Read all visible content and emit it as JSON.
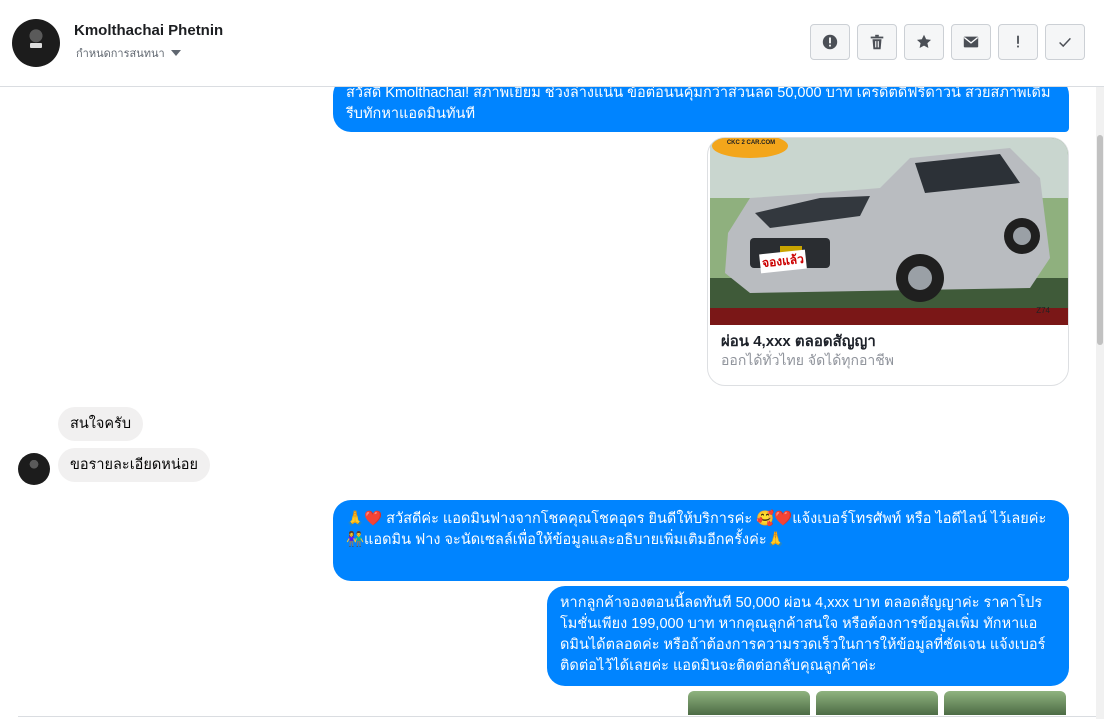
{
  "header": {
    "contact_name": "Kmolthachai Phetnin",
    "conversation_settings_label": "กำหนดการสนทนา",
    "toolbar": [
      {
        "name": "report-spam-button",
        "icon": "alert-circle-icon"
      },
      {
        "name": "delete-button",
        "icon": "trash-icon"
      },
      {
        "name": "star-button",
        "icon": "star-icon"
      },
      {
        "name": "mark-unread-button",
        "icon": "envelope-icon"
      },
      {
        "name": "follow-up-button",
        "icon": "exclamation-icon"
      },
      {
        "name": "mark-done-button",
        "icon": "check-icon"
      }
    ]
  },
  "messages": {
    "outgoing_1": "สวัสดี Kmolthachai! สภาพเยี่ยม ช่วงล่างแน่น ข้อต่อนนคุ้มกว่าส่วนลด 50,000 บาท เครดิตดีฟรีดาวน์ สวยสภาพเดิม รีบทักหาแอดมินทันที",
    "card": {
      "title": "ผ่อน 4,xxx ตลอดสัญญา",
      "subtitle": "ออกได้ทั่วไทย จัดได้ทุกอาชีพ",
      "photo_brand": "CKC 2 CAR.COM",
      "photo_badge": "จองแล้ว",
      "photo_code": "Z74"
    },
    "incoming_1": "สนใจครับ",
    "incoming_2": "ขอรายละเอียดหน่อย",
    "outgoing_2_line1": "🙏❤️ สวัสดีค่ะ แอดมินฟางจากโชคคุณโชคอุดร ยินดีให้บริการค่ะ 🥰❤️แจ้งเบอร์โทรศัพท์ หรือ ไอดีไลน์ ไว้เลยค่ะ",
    "outgoing_2_line2": "👫แอดมิน ฟาง จะนัดเซลล์เพื่อให้ข้อมูลและอธิบายเพิ่มเติมอีกครั้งค่ะ🙏",
    "outgoing_3": "หากลูกค้าจองตอนนี้ลดทันที 50,000 ผ่อน 4,xxx บาท ตลอดสัญญาค่ะ ราคาโปรโมชั่นเพียง 199,000 บาท หากคุณลูกค้าสนใจ หรือต้องการข้อมูลเพิ่ม ทักหาแอดมินได้ตลอดค่ะ หรือถ้าต้องการความรวดเร็วในการให้ข้อมูลที่ชัดเจน แจ้งเบอร์ติดต่อไว้ได้เลยค่ะ แอดมินจะติดต่อกลับคุณลูกค้าค่ะ"
  },
  "colors": {
    "outgoing_bubble": "#0084ff",
    "incoming_bubble": "#f1f0f0"
  }
}
